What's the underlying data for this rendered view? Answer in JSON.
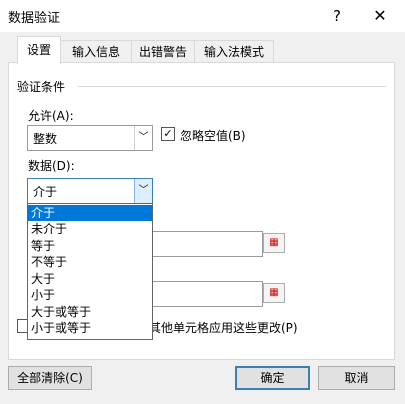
{
  "window": {
    "title": "数据验证",
    "help_glyph": "?",
    "close_glyph": "✕"
  },
  "tabs": [
    {
      "label": "设置",
      "active": true
    },
    {
      "label": "输入信息",
      "active": false
    },
    {
      "label": "出错警告",
      "active": false
    },
    {
      "label": "输入法模式",
      "active": false
    }
  ],
  "criteria": {
    "section_title": "验证条件",
    "allow_label": "允许(A):",
    "allow_value": "整数",
    "ignore_blank_label": "忽略空值(B)",
    "ignore_blank_checked": true,
    "data_label": "数据(D):",
    "data_value": "介于",
    "data_options": [
      "介于",
      "未介于",
      "等于",
      "不等于",
      "大于",
      "小于",
      "大于或等于",
      "小于或等于"
    ],
    "selected_option": "介于"
  },
  "apply": {
    "label": "其他单元格应用这些更改(P)",
    "checked": false
  },
  "buttons": {
    "clear_all": "全部清除(C)",
    "ok": "确定",
    "cancel": "取消"
  },
  "colors": {
    "selection": "#0078d7",
    "focus_border": "#3c7fb1"
  },
  "icons": {
    "dropdown_arrow": "﹀",
    "checkmark": "✓",
    "range_select": "▦"
  }
}
